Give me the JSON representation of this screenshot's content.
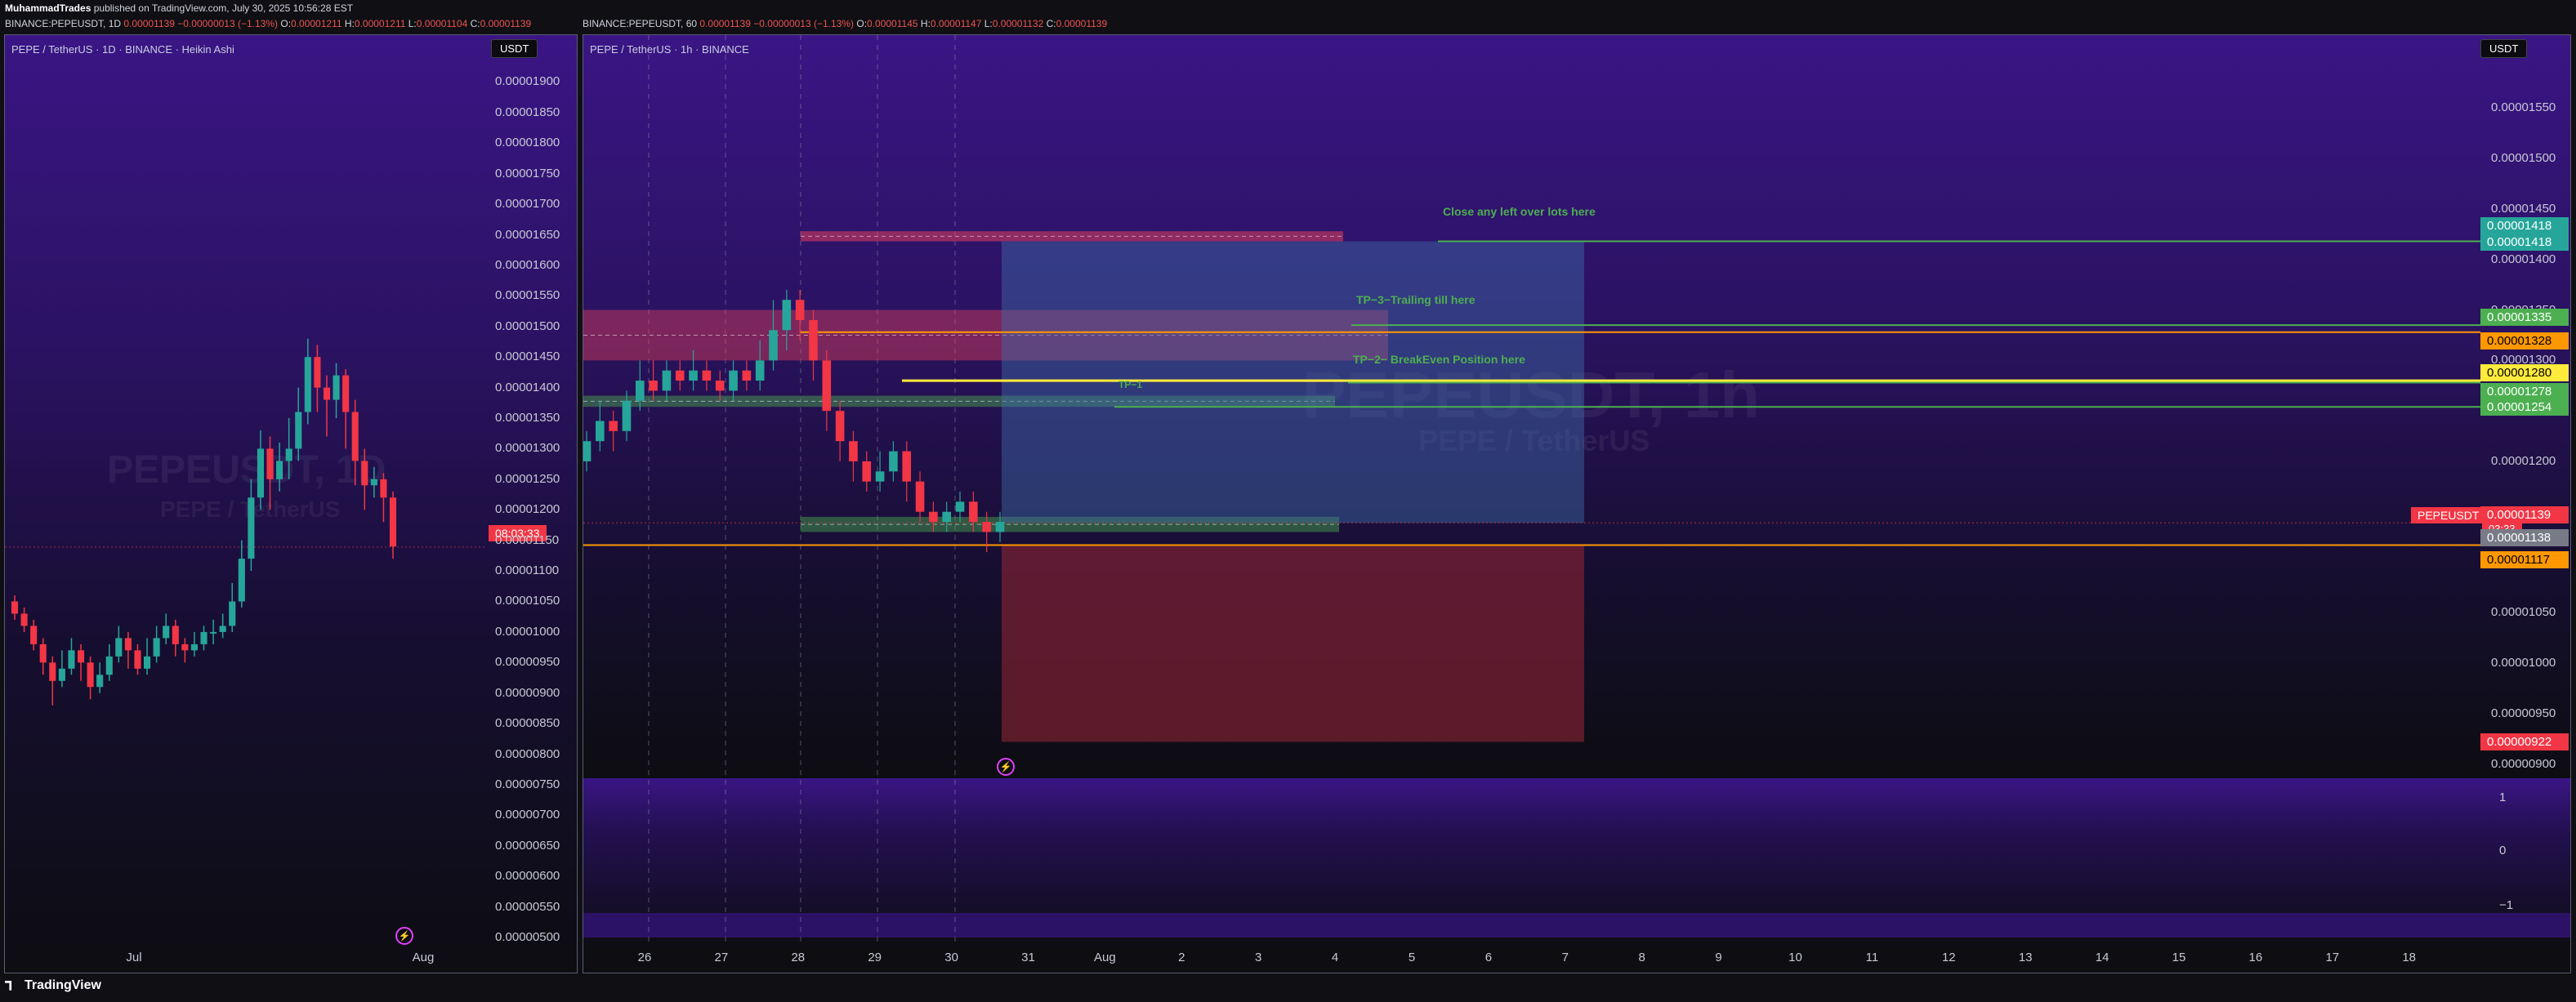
{
  "header": {
    "publisher_name": "MuhammadTrades",
    "publisher_text": "published on TradingView.com, July 30, 2025 10:56:28 EST",
    "left": {
      "symbol": "BINANCE:PEPEUSDT, 1D",
      "close": "0.00001139",
      "change": "−0.00000013 (−1.13%)",
      "o_label": "O:",
      "o": "0.00001211",
      "h_label": "H:",
      "h": "0.00001211",
      "l_label": "L:",
      "l": "0.00001104",
      "c_label": "C:",
      "c": "0.00001139"
    },
    "right": {
      "symbol": "BINANCE:PEPEUSDT, 60",
      "close": "0.00001139",
      "change": "−0.00000013 (−1.13%)",
      "o_label": "O:",
      "o": "0.00001145",
      "h_label": "H:",
      "h": "0.00001147",
      "l_label": "L:",
      "l": "0.00001132",
      "c_label": "C:",
      "c": "0.00001139"
    }
  },
  "left_panel": {
    "title": "PEPE / TetherUS · 1D · BINANCE · Heikin Ashi",
    "unit": "USDT",
    "watermark_symbol": "PEPEUSDT, 1D",
    "watermark_name": "PEPE / TetherUS",
    "countdown": "08:03:33"
  },
  "right_panel": {
    "title": "PEPE / TetherUS · 1h · BINANCE",
    "unit": "USDT",
    "watermark_symbol": "PEPEUSDT, 1h",
    "watermark_name": "PEPE / TetherUS",
    "symbol_tag": "PEPEUSDT",
    "countdown": "03:33"
  },
  "annotations": {
    "close_lots": "Close any left over lots here",
    "tp3": "TP−3−Trailing till here",
    "tp2": "TP−2− BreakEven Position here",
    "tp1": "TP−1"
  },
  "price_tags": [
    {
      "value": "0.00001418",
      "bg": "#26a69a",
      "fg": "#ffffff"
    },
    {
      "value": "0.00001418",
      "bg": "#26a69a",
      "fg": "#ffffff"
    },
    {
      "value": "0.00001335",
      "bg": "#4caf50",
      "fg": "#ffffff"
    },
    {
      "value": "0.00001328",
      "bg": "#ff9800",
      "fg": "#000000"
    },
    {
      "value": "0.00001280",
      "bg": "#ffeb3b",
      "fg": "#000000"
    },
    {
      "value": "0.00001278",
      "bg": "#4caf50",
      "fg": "#ffffff"
    },
    {
      "value": "0.00001254",
      "bg": "#4caf50",
      "fg": "#ffffff"
    },
    {
      "value": "0.00001139",
      "bg": "#f23645",
      "fg": "#ffffff"
    },
    {
      "value": "0.00001138",
      "bg": "#787b86",
      "fg": "#ffffff"
    },
    {
      "value": "0.00001117",
      "bg": "#ff9800",
      "fg": "#000000"
    },
    {
      "value": "0.00000922",
      "bg": "#f23645",
      "fg": "#ffffff"
    }
  ],
  "footer": {
    "brand": "TradingView"
  },
  "chart_data": [
    {
      "type": "candlestick",
      "style": "heikin-ashi",
      "ylim": [
        4.8e-06,
        1.91e-05
      ],
      "y_ticks": [
        "0.00001900",
        "0.00001850",
        "0.00001800",
        "0.00001750",
        "0.00001700",
        "0.00001650",
        "0.00001600",
        "0.00001550",
        "0.00001500",
        "0.00001450",
        "0.00001400",
        "0.00001350",
        "0.00001300",
        "0.00001250",
        "0.00001200",
        "0.00001150",
        "0.00001100",
        "0.00001050",
        "0.00001000",
        "0.00000950",
        "0.00000900",
        "0.00000850",
        "0.00000800",
        "0.00000750",
        "0.00000700",
        "0.00000650",
        "0.00000600",
        "0.00000550",
        "0.00000500"
      ],
      "x_ticks": [
        "Jul",
        "Aug"
      ],
      "candles": [
        [
          1.05,
          1.03,
          1.06,
          1.02
        ],
        [
          1.03,
          1.01,
          1.04,
          1.0
        ],
        [
          1.01,
          0.98,
          1.02,
          0.97
        ],
        [
          0.98,
          0.95,
          0.99,
          0.93
        ],
        [
          0.95,
          0.92,
          0.96,
          0.88
        ],
        [
          0.92,
          0.94,
          0.97,
          0.91
        ],
        [
          0.94,
          0.97,
          0.99,
          0.93
        ],
        [
          0.97,
          0.95,
          0.98,
          0.92
        ],
        [
          0.95,
          0.91,
          0.96,
          0.89
        ],
        [
          0.91,
          0.93,
          0.95,
          0.9
        ],
        [
          0.93,
          0.96,
          0.98,
          0.92
        ],
        [
          0.96,
          0.99,
          1.01,
          0.95
        ],
        [
          0.99,
          0.97,
          1.0,
          0.94
        ],
        [
          0.97,
          0.94,
          0.98,
          0.93
        ],
        [
          0.94,
          0.96,
          0.99,
          0.93
        ],
        [
          0.96,
          0.99,
          1.01,
          0.95
        ],
        [
          0.99,
          1.01,
          1.03,
          0.98
        ],
        [
          1.01,
          0.98,
          1.02,
          0.96
        ],
        [
          0.98,
          0.97,
          0.99,
          0.95
        ],
        [
          0.97,
          0.98,
          1.0,
          0.96
        ],
        [
          0.98,
          1.0,
          1.01,
          0.97
        ],
        [
          1.0,
          1.0,
          1.02,
          0.98
        ],
        [
          1.0,
          1.01,
          1.03,
          0.99
        ],
        [
          1.01,
          1.05,
          1.08,
          1.0
        ],
        [
          1.05,
          1.12,
          1.15,
          1.04
        ],
        [
          1.12,
          1.22,
          1.25,
          1.1
        ],
        [
          1.22,
          1.3,
          1.33,
          1.2
        ],
        [
          1.3,
          1.25,
          1.32,
          1.2
        ],
        [
          1.25,
          1.28,
          1.31,
          1.23
        ],
        [
          1.28,
          1.3,
          1.35,
          1.25
        ],
        [
          1.3,
          1.36,
          1.4,
          1.28
        ],
        [
          1.36,
          1.45,
          1.48,
          1.34
        ],
        [
          1.45,
          1.4,
          1.47,
          1.36
        ],
        [
          1.4,
          1.38,
          1.42,
          1.32
        ],
        [
          1.38,
          1.42,
          1.44,
          1.35
        ],
        [
          1.42,
          1.36,
          1.43,
          1.3
        ],
        [
          1.36,
          1.28,
          1.38,
          1.24
        ],
        [
          1.28,
          1.24,
          1.3,
          1.2
        ],
        [
          1.24,
          1.25,
          1.27,
          1.22
        ],
        [
          1.25,
          1.22,
          1.26,
          1.18
        ],
        [
          1.22,
          1.14,
          1.23,
          1.12
        ]
      ]
    },
    {
      "type": "candlestick",
      "style": "standard",
      "ylim": [
        8.9e-06,
        1.59e-05
      ],
      "y_ticks": [
        "0.00001550",
        "0.00001500",
        "0.00001450",
        "0.00001400",
        "0.00001350",
        "0.00001300",
        "0.00001250",
        "0.00001200",
        "0.00001150",
        "0.00001100",
        "0.00001050",
        "0.00001000",
        "0.00000950",
        "0.00000900"
      ],
      "x_ticks": [
        "26",
        "27",
        "28",
        "29",
        "30",
        "31",
        "Aug",
        "2",
        "3",
        "4",
        "5",
        "6",
        "7",
        "8",
        "9",
        "10",
        "11",
        "12",
        "13",
        "14",
        "15",
        "16",
        "17",
        "18"
      ],
      "lower_pane_ticks": [
        "1",
        "0",
        "−1"
      ],
      "zones": [
        {
          "name": "supply-zone-top",
          "from": 1.418e-05,
          "to": 1.428e-05,
          "color": "#e0405a"
        },
        {
          "name": "supply-zone-mid",
          "from": 1.3e-05,
          "to": 1.35e-05,
          "color": "#e0405a"
        },
        {
          "name": "demand-zone-tp1",
          "from": 1.254e-05,
          "to": 1.265e-05,
          "color": "#4caf50"
        },
        {
          "name": "demand-zone-low",
          "from": 1.13e-05,
          "to": 1.145e-05,
          "color": "#4caf50"
        },
        {
          "name": "target-box",
          "from": 1.139e-05,
          "to": 1.418e-05,
          "color": "#3d6ca8"
        },
        {
          "name": "stop-box",
          "from": 9.22e-06,
          "to": 1.117e-05,
          "color": "#8e2436"
        }
      ],
      "levels": [
        {
          "name": "close-lots-line",
          "value": 1.418e-05,
          "color": "#4caf50"
        },
        {
          "name": "tp3-line",
          "value": 1.335e-05,
          "color": "#4caf50"
        },
        {
          "name": "orange-top-line",
          "value": 1.328e-05,
          "color": "#ff9800"
        },
        {
          "name": "yellow-line",
          "value": 1.28e-05,
          "color": "#ffeb3b"
        },
        {
          "name": "tp2-line",
          "value": 1.278e-05,
          "color": "#4caf50"
        },
        {
          "name": "tp1-line",
          "value": 1.254e-05,
          "color": "#4caf50"
        },
        {
          "name": "orange-bottom-line",
          "value": 1.117e-05,
          "color": "#ff9800"
        }
      ],
      "candles": [
        [
          1.2,
          1.22,
          1.23,
          1.19
        ],
        [
          1.22,
          1.24,
          1.26,
          1.21
        ],
        [
          1.24,
          1.23,
          1.25,
          1.21
        ],
        [
          1.23,
          1.26,
          1.27,
          1.22
        ],
        [
          1.26,
          1.28,
          1.3,
          1.25
        ],
        [
          1.28,
          1.27,
          1.3,
          1.26
        ],
        [
          1.27,
          1.29,
          1.3,
          1.26
        ],
        [
          1.29,
          1.28,
          1.3,
          1.27
        ],
        [
          1.28,
          1.29,
          1.31,
          1.27
        ],
        [
          1.29,
          1.28,
          1.3,
          1.27
        ],
        [
          1.28,
          1.27,
          1.29,
          1.26
        ],
        [
          1.27,
          1.29,
          1.3,
          1.26
        ],
        [
          1.29,
          1.28,
          1.3,
          1.27
        ],
        [
          1.28,
          1.3,
          1.32,
          1.27
        ],
        [
          1.3,
          1.33,
          1.36,
          1.29
        ],
        [
          1.33,
          1.36,
          1.37,
          1.31
        ],
        [
          1.36,
          1.34,
          1.37,
          1.32
        ],
        [
          1.34,
          1.3,
          1.35,
          1.28
        ],
        [
          1.3,
          1.25,
          1.31,
          1.23
        ],
        [
          1.25,
          1.22,
          1.26,
          1.2
        ],
        [
          1.22,
          1.2,
          1.23,
          1.18
        ],
        [
          1.2,
          1.18,
          1.21,
          1.17
        ],
        [
          1.18,
          1.19,
          1.21,
          1.17
        ],
        [
          1.19,
          1.21,
          1.22,
          1.18
        ],
        [
          1.21,
          1.18,
          1.22,
          1.16
        ],
        [
          1.18,
          1.15,
          1.19,
          1.14
        ],
        [
          1.15,
          1.14,
          1.16,
          1.13
        ],
        [
          1.14,
          1.15,
          1.16,
          1.13
        ],
        [
          1.15,
          1.16,
          1.17,
          1.14
        ],
        [
          1.16,
          1.14,
          1.17,
          1.13
        ],
        [
          1.14,
          1.13,
          1.15,
          1.11
        ],
        [
          1.13,
          1.14,
          1.15,
          1.12
        ]
      ]
    }
  ]
}
